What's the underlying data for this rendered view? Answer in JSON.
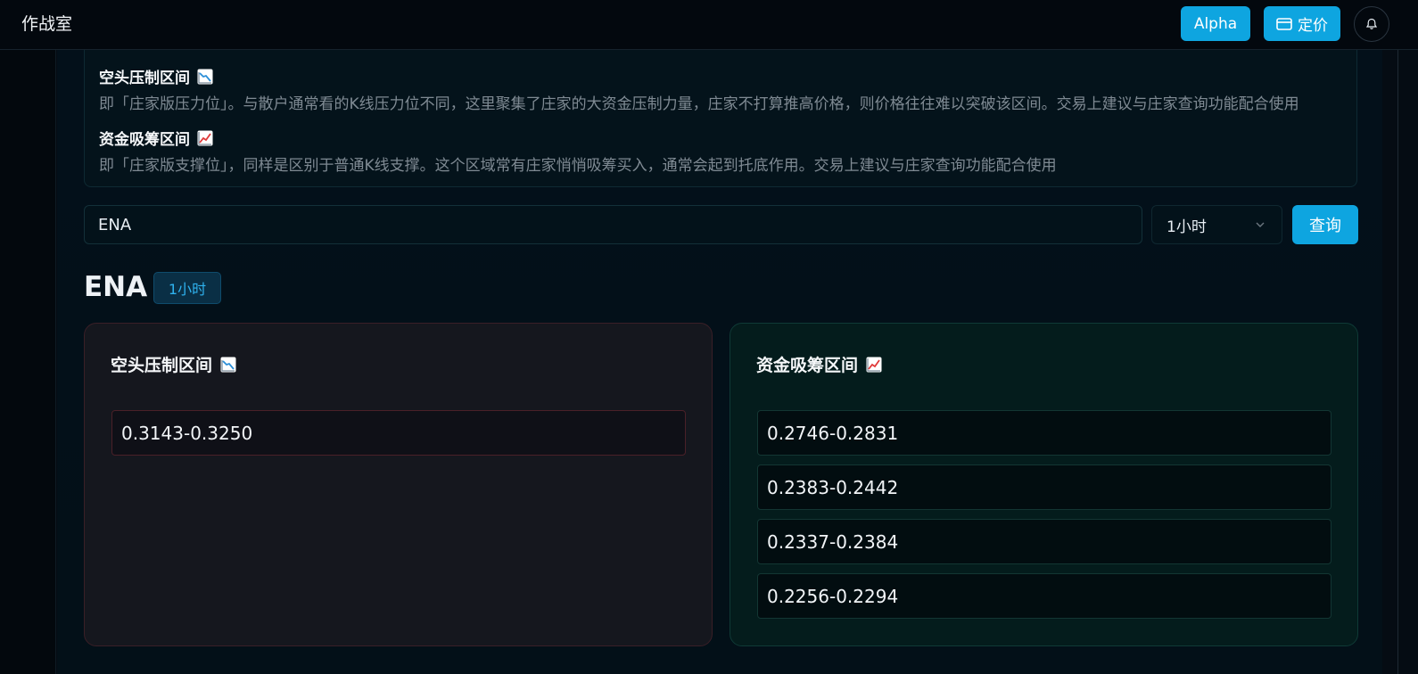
{
  "header": {
    "app_title": "作战室",
    "alpha_label": "Alpha",
    "pricing_label": "定价"
  },
  "info": {
    "bear_title": "空头压制区间",
    "bear_desc": "即「庄家版压力位」。与散户通常看的K线压力位不同，这里聚集了庄家的大资金压制力量，庄家不打算推高价格，则价格往往难以突破该区间。交易上建议与庄家查询功能配合使用",
    "bull_title": "资金吸筹区间",
    "bull_desc": "即「庄家版支撑位」，同样是区别于普通K线支撑。这个区域常有庄家悄悄吸筹买入，通常会起到托底作用。交易上建议与庄家查询功能配合使用"
  },
  "search": {
    "value": "ENA",
    "interval": "1小时",
    "query_label": "查询"
  },
  "result": {
    "symbol": "ENA",
    "interval_tag": "1小时",
    "bear_card_title": "空头压制区间",
    "bull_card_title": "资金吸筹区间",
    "bear_ranges": [
      "0.3143-0.3250"
    ],
    "bull_ranges": [
      "0.2746-0.2831",
      "0.2383-0.2442",
      "0.2337-0.2384",
      "0.2256-0.2294"
    ]
  },
  "icons": {
    "bear": "chart-decreasing-icon",
    "bull": "chart-increasing-icon",
    "pricing": "card-icon",
    "bell": "bell-icon",
    "chevron": "chevron-down-icon"
  },
  "colors": {
    "accent": "#0ea5e0",
    "bear_border": "#4a2028",
    "bull_border": "#133633"
  }
}
